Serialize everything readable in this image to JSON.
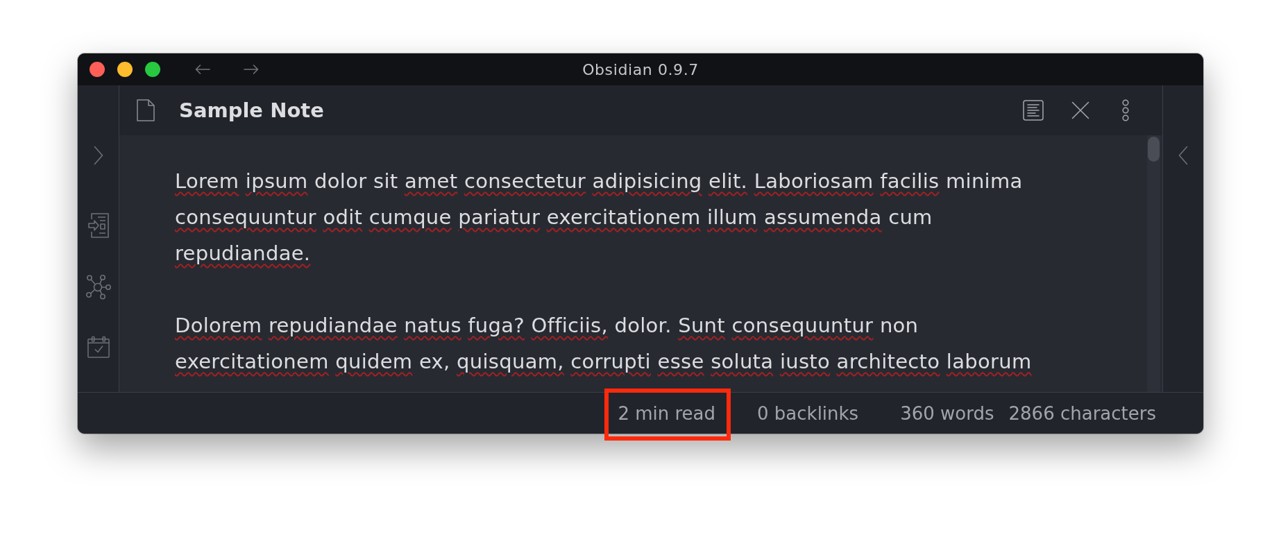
{
  "window": {
    "title": "Obsidian 0.9.7"
  },
  "note": {
    "title": "Sample Note",
    "paragraphs": [
      {
        "lines": [
          [
            {
              "text": "Lorem",
              "misspelled": true
            },
            {
              "text": "ipsum",
              "misspelled": true
            },
            {
              "text": "dolor",
              "misspelled": false
            },
            {
              "text": "sit",
              "misspelled": false
            },
            {
              "text": "amet",
              "misspelled": true
            },
            {
              "text": "consectetur",
              "misspelled": true
            },
            {
              "text": "adipisicing",
              "misspelled": true
            },
            {
              "text": "elit.",
              "misspelled": true
            },
            {
              "text": "Laboriosam",
              "misspelled": true
            },
            {
              "text": "facilis",
              "misspelled": true
            },
            {
              "text": "minima",
              "misspelled": false
            }
          ],
          [
            {
              "text": "consequuntur",
              "misspelled": true
            },
            {
              "text": "odit",
              "misspelled": true
            },
            {
              "text": "cumque",
              "misspelled": true
            },
            {
              "text": "pariatur",
              "misspelled": true
            },
            {
              "text": "exercitationem",
              "misspelled": true
            },
            {
              "text": "illum",
              "misspelled": true
            },
            {
              "text": "assumenda",
              "misspelled": true
            },
            {
              "text": "cum",
              "misspelled": false
            }
          ],
          [
            {
              "text": "repudiandae.",
              "misspelled": true
            }
          ]
        ]
      },
      {
        "lines": [
          [
            {
              "text": "Dolorem",
              "misspelled": true
            },
            {
              "text": "repudiandae",
              "misspelled": true
            },
            {
              "text": "natus",
              "misspelled": true
            },
            {
              "text": "fuga?",
              "misspelled": true
            },
            {
              "text": "Officiis,",
              "misspelled": true
            },
            {
              "text": "dolor.",
              "misspelled": false
            },
            {
              "text": "Sunt",
              "misspelled": true
            },
            {
              "text": "consequuntur",
              "misspelled": true
            },
            {
              "text": "non",
              "misspelled": false
            }
          ],
          [
            {
              "text": "exercitationem",
              "misspelled": true
            },
            {
              "text": "quidem",
              "misspelled": true
            },
            {
              "text": "ex,",
              "misspelled": false
            },
            {
              "text": "quisquam,",
              "misspelled": true
            },
            {
              "text": "corrupti",
              "misspelled": true
            },
            {
              "text": "esse",
              "misspelled": true
            },
            {
              "text": "soluta",
              "misspelled": true
            },
            {
              "text": "iusto",
              "misspelled": true
            },
            {
              "text": "architecto",
              "misspelled": true
            },
            {
              "text": "laborum",
              "misspelled": true
            }
          ]
        ]
      }
    ]
  },
  "status_bar": [
    {
      "parts": [
        "2 min read"
      ],
      "highlighted": true
    },
    {
      "parts": [
        "0 backlinks"
      ],
      "highlighted": false
    },
    {
      "parts": [
        "360 words",
        "2866 characters"
      ],
      "highlighted": false
    }
  ]
}
